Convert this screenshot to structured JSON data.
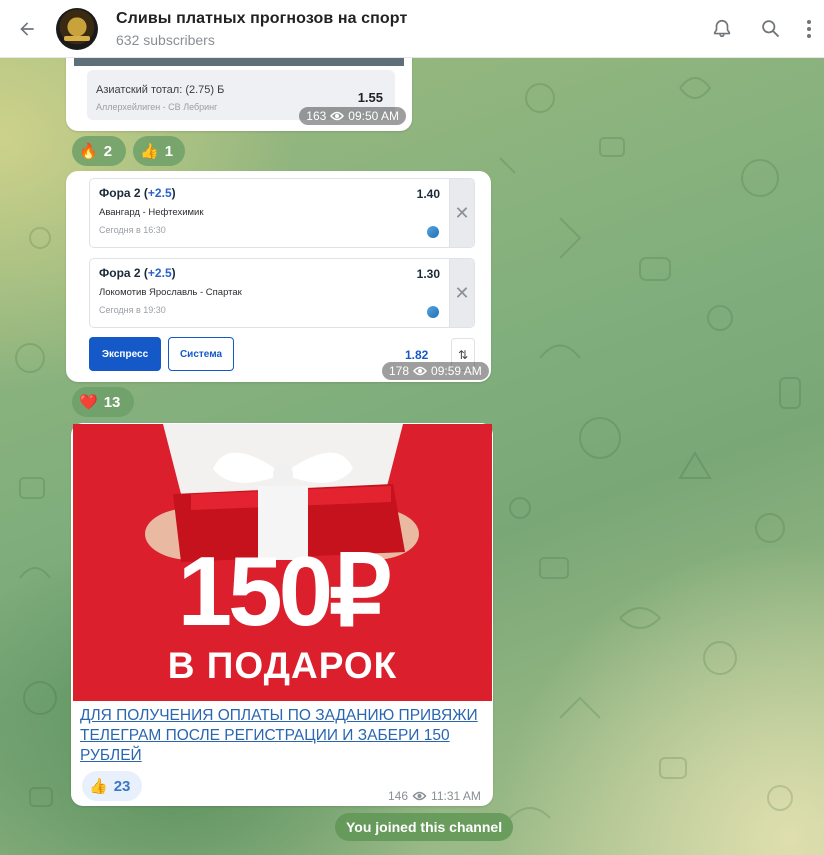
{
  "header": {
    "title": "Сливы платных прогнозов на спорт",
    "subtitle": "632 subscribers"
  },
  "messages": [
    {
      "bet": {
        "label": "Азиатский тотал: (2.75) Б",
        "match": "Аллерхейлиген - СВ Лебринг",
        "odds": "1.55"
      },
      "views": "163",
      "time": "09:50 AM",
      "reactions": [
        {
          "emoji": "🔥",
          "count": "2"
        },
        {
          "emoji": "👍",
          "count": "1"
        }
      ]
    },
    {
      "selections": [
        {
          "type": "Фора 2 (",
          "handicap": "+2.5",
          "close": ")",
          "odds": "1.40",
          "match": "Авангард - Нефтехимик",
          "when": "Сегодня в 16:30"
        },
        {
          "type": "Фора 2 (",
          "handicap": "+2.5",
          "close": ")",
          "odds": "1.30",
          "match": "Локомотив Ярославль - Спартак",
          "when": "Сегодня в 19:30"
        }
      ],
      "express_label": "Экспресс",
      "system_label": "Система",
      "total_odds": "1.82",
      "views": "178",
      "time": "09:59 AM",
      "reactions": [
        {
          "emoji": "❤️",
          "count": "13"
        }
      ]
    },
    {
      "promo": {
        "amount": "150₽",
        "line2": "В ПОДАРОК"
      },
      "text": "ДЛЯ ПОЛУЧЕНИЯ ОПЛАТЫ ПО ЗАДАНИЮ ПРИВЯЖИ ТЕЛЕГРАМ ПОСЛЕ РЕГИСТРАЦИИ И ЗАБЕРИ 150 РУБЛЕЙ",
      "views": "146",
      "time": "11:31 AM",
      "reactions": [
        {
          "emoji": "👍",
          "count": "23"
        }
      ]
    }
  ],
  "service_message": "You joined this channel",
  "colors": {
    "accent": "#3a77c4",
    "bet_blue": "#1559c9",
    "promo_red": "#dc1f2c"
  }
}
